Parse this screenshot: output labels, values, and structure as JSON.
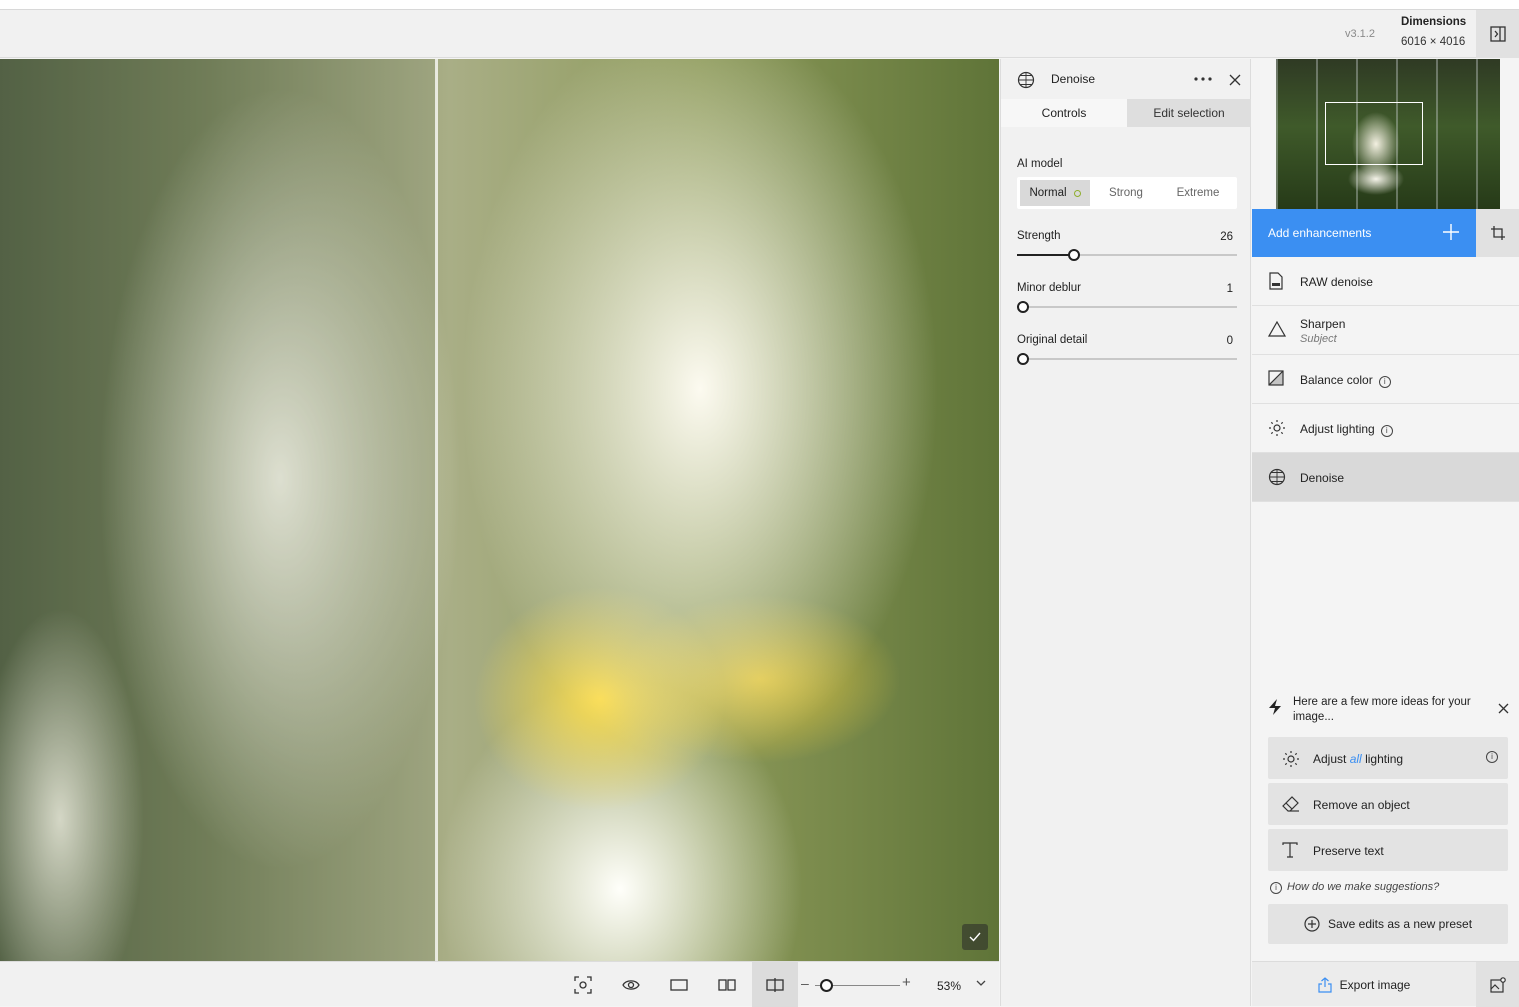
{
  "header": {
    "version": "v3.1.2",
    "dimensions_title": "Dimensions",
    "dimensions_value": "6016 × 4016",
    "panel_toggle_icon": "sidebar-panel-icon"
  },
  "viewport": {
    "confirm_icon": "check-icon"
  },
  "toolbar": {
    "buttons": [
      "focus-frame-icon",
      "eye-icon",
      "single-view-icon",
      "side-by-side-icon",
      "split-view-icon"
    ],
    "zoom_value": "53%",
    "zoom_level": 0.1
  },
  "controls": {
    "title": "Denoise",
    "tabs": [
      "Controls",
      "Edit selection"
    ],
    "ai_model_label": "AI model",
    "models": [
      "Normal",
      "Strong",
      "Extreme"
    ],
    "selected_model": "Normal",
    "sliders": [
      {
        "label": "Strength",
        "value": "26",
        "fraction": 0.26
      },
      {
        "label": "Minor deblur",
        "value": "1",
        "fraction": 0.0
      },
      {
        "label": "Original detail",
        "value": "0",
        "fraction": 0.0
      }
    ]
  },
  "sidebar": {
    "add_enhancements": "Add enhancements",
    "enhancements": [
      {
        "name": "RAW denoise",
        "icon": "raw-file-icon"
      },
      {
        "name": "Sharpen",
        "sub": "Subject",
        "icon": "triangle-icon"
      },
      {
        "name": "Balance color",
        "icon": "balance-icon"
      },
      {
        "name": "Adjust lighting",
        "icon": "sun-icon"
      },
      {
        "name": "Denoise",
        "icon": "denoise-icon"
      }
    ],
    "ideas_heading": "Here are a few more ideas for your image...",
    "ideas": [
      {
        "pre": "Adjust",
        "mid": "all",
        "post": "lighting"
      },
      {
        "label": "Remove an object"
      },
      {
        "label": "Preserve text"
      }
    ],
    "how_suggestions": "How do we make suggestions?",
    "save_preset": "Save edits as a new preset",
    "export": "Export image"
  },
  "colors": {
    "accent": "#3b8ff2",
    "panel_bg": "#f1f1f1",
    "selected_row": "#d9d9d9"
  }
}
